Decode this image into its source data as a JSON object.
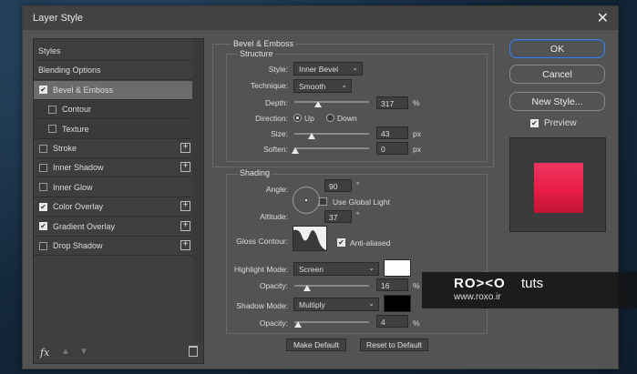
{
  "dialog": {
    "title": "Layer Style"
  },
  "left_panel": {
    "items": [
      {
        "label": "Styles",
        "checkbox": null,
        "plus": false
      },
      {
        "label": "Blending Options",
        "checkbox": null,
        "plus": false
      },
      {
        "label": "Bevel & Emboss",
        "checkbox": true,
        "plus": false,
        "selected": true
      },
      {
        "label": "Contour",
        "checkbox": false,
        "plus": false,
        "sub": true
      },
      {
        "label": "Texture",
        "checkbox": false,
        "plus": false,
        "sub": true
      },
      {
        "label": "Stroke",
        "checkbox": false,
        "plus": true
      },
      {
        "label": "Inner Shadow",
        "checkbox": false,
        "plus": true
      },
      {
        "label": "Inner Glow",
        "checkbox": false,
        "plus": false
      },
      {
        "label": "Color Overlay",
        "checkbox": true,
        "plus": true
      },
      {
        "label": "Gradient Overlay",
        "checkbox": true,
        "plus": true
      },
      {
        "label": "Drop Shadow",
        "checkbox": false,
        "plus": true
      }
    ],
    "fx_label": "fx"
  },
  "bevel": {
    "group_title": "Bevel & Emboss",
    "structure_title": "Structure",
    "style_label": "Style:",
    "style_value": "Inner Bevel",
    "technique_label": "Technique:",
    "technique_value": "Smooth",
    "depth_label": "Depth:",
    "depth_value": "317",
    "depth_unit": "%",
    "direction_label": "Direction:",
    "direction_up": "Up",
    "direction_down": "Down",
    "size_label": "Size:",
    "size_value": "43",
    "size_unit": "px",
    "soften_label": "Soften:",
    "soften_value": "0",
    "soften_unit": "px"
  },
  "shading": {
    "title": "Shading",
    "angle_label": "Angle:",
    "angle_value": "90",
    "angle_unit": "°",
    "global_light_label": "Use Global Light",
    "altitude_label": "Altitude:",
    "altitude_value": "37",
    "altitude_unit": "°",
    "gloss_label": "Gloss Contour:",
    "anti_aliased_label": "Anti-aliased",
    "highlight_mode_label": "Highlight Mode:",
    "highlight_mode_value": "Screen",
    "highlight_color": "#ffffff",
    "highlight_opacity_label": "Opacity:",
    "highlight_opacity_value": "16",
    "highlight_opacity_unit": "%",
    "shadow_mode_label": "Shadow Mode:",
    "shadow_mode_value": "Multiply",
    "shadow_color": "#000000",
    "shadow_opacity_label": "Opacity:",
    "shadow_opacity_value": "4",
    "shadow_opacity_unit": "%"
  },
  "footer": {
    "make_default": "Make Default",
    "reset_default": "Reset to Default"
  },
  "right": {
    "ok": "OK",
    "cancel": "Cancel",
    "new_style": "New Style...",
    "preview_label": "Preview",
    "preview_checked": true
  },
  "watermark": {
    "logo": "RO><O",
    "tuts": "tuts",
    "url": "www.roxo.ir"
  }
}
